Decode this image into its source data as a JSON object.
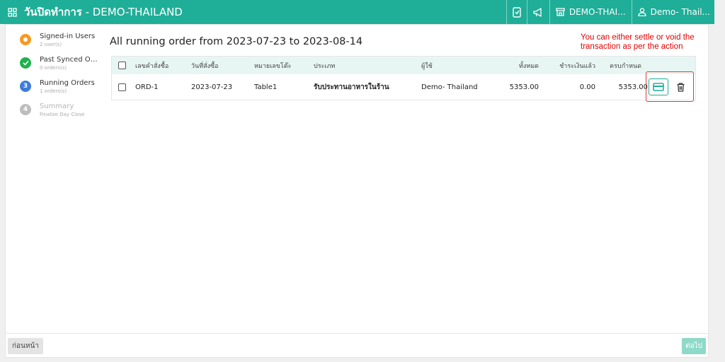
{
  "header": {
    "title_bold": "วันปิดทำการ",
    "title_rest": " - DEMO-THAILAND",
    "store_label": "DEMO-THAI...",
    "user_label": "Demo- Thail...",
    "bg_color": "#1fae98"
  },
  "steps": [
    {
      "label": "Signed-in Users",
      "sub": "2 user(s)",
      "state": "current",
      "color": "#f59a23",
      "dot_text": ""
    },
    {
      "label": "Past Synced Or...",
      "sub": "0 orders(s)",
      "state": "done",
      "color": "#22b14c",
      "dot_text": "✓"
    },
    {
      "label": "Running Orders",
      "sub": "1 orders(s)",
      "state": "active",
      "color": "#3d7bdc",
      "dot_text": "3"
    },
    {
      "label": "Summary",
      "sub": "Finalize Day Close",
      "state": "inactive",
      "color": "#bdbdbd",
      "dot_text": "4"
    }
  ],
  "main": {
    "heading": "All running order from 2023-07-23 to 2023-08-14",
    "annotation": "You can either settle or void the transaction as per the action"
  },
  "table": {
    "columns": [
      "เลขคำสั่งซื้อ",
      "วันที่สั่งซื้อ",
      "หมายเลขโต๊ะ",
      "ประเภท",
      "ผู้ใช้",
      "ทั้งหมด",
      "ชำระเงินแล้ว",
      "ครบกำหนด"
    ],
    "rows": [
      {
        "order": "ORD-1",
        "date": "2023-07-23",
        "table_no": "Table1",
        "type": "รับประทานอาหารในร้าน",
        "user": "Demo- Thailand",
        "total": "5353.00",
        "paid": "0.00",
        "due": "5353.00"
      }
    ]
  },
  "footer": {
    "back_label": "ก่อนหน้า",
    "next_label": "ต่อไป"
  }
}
